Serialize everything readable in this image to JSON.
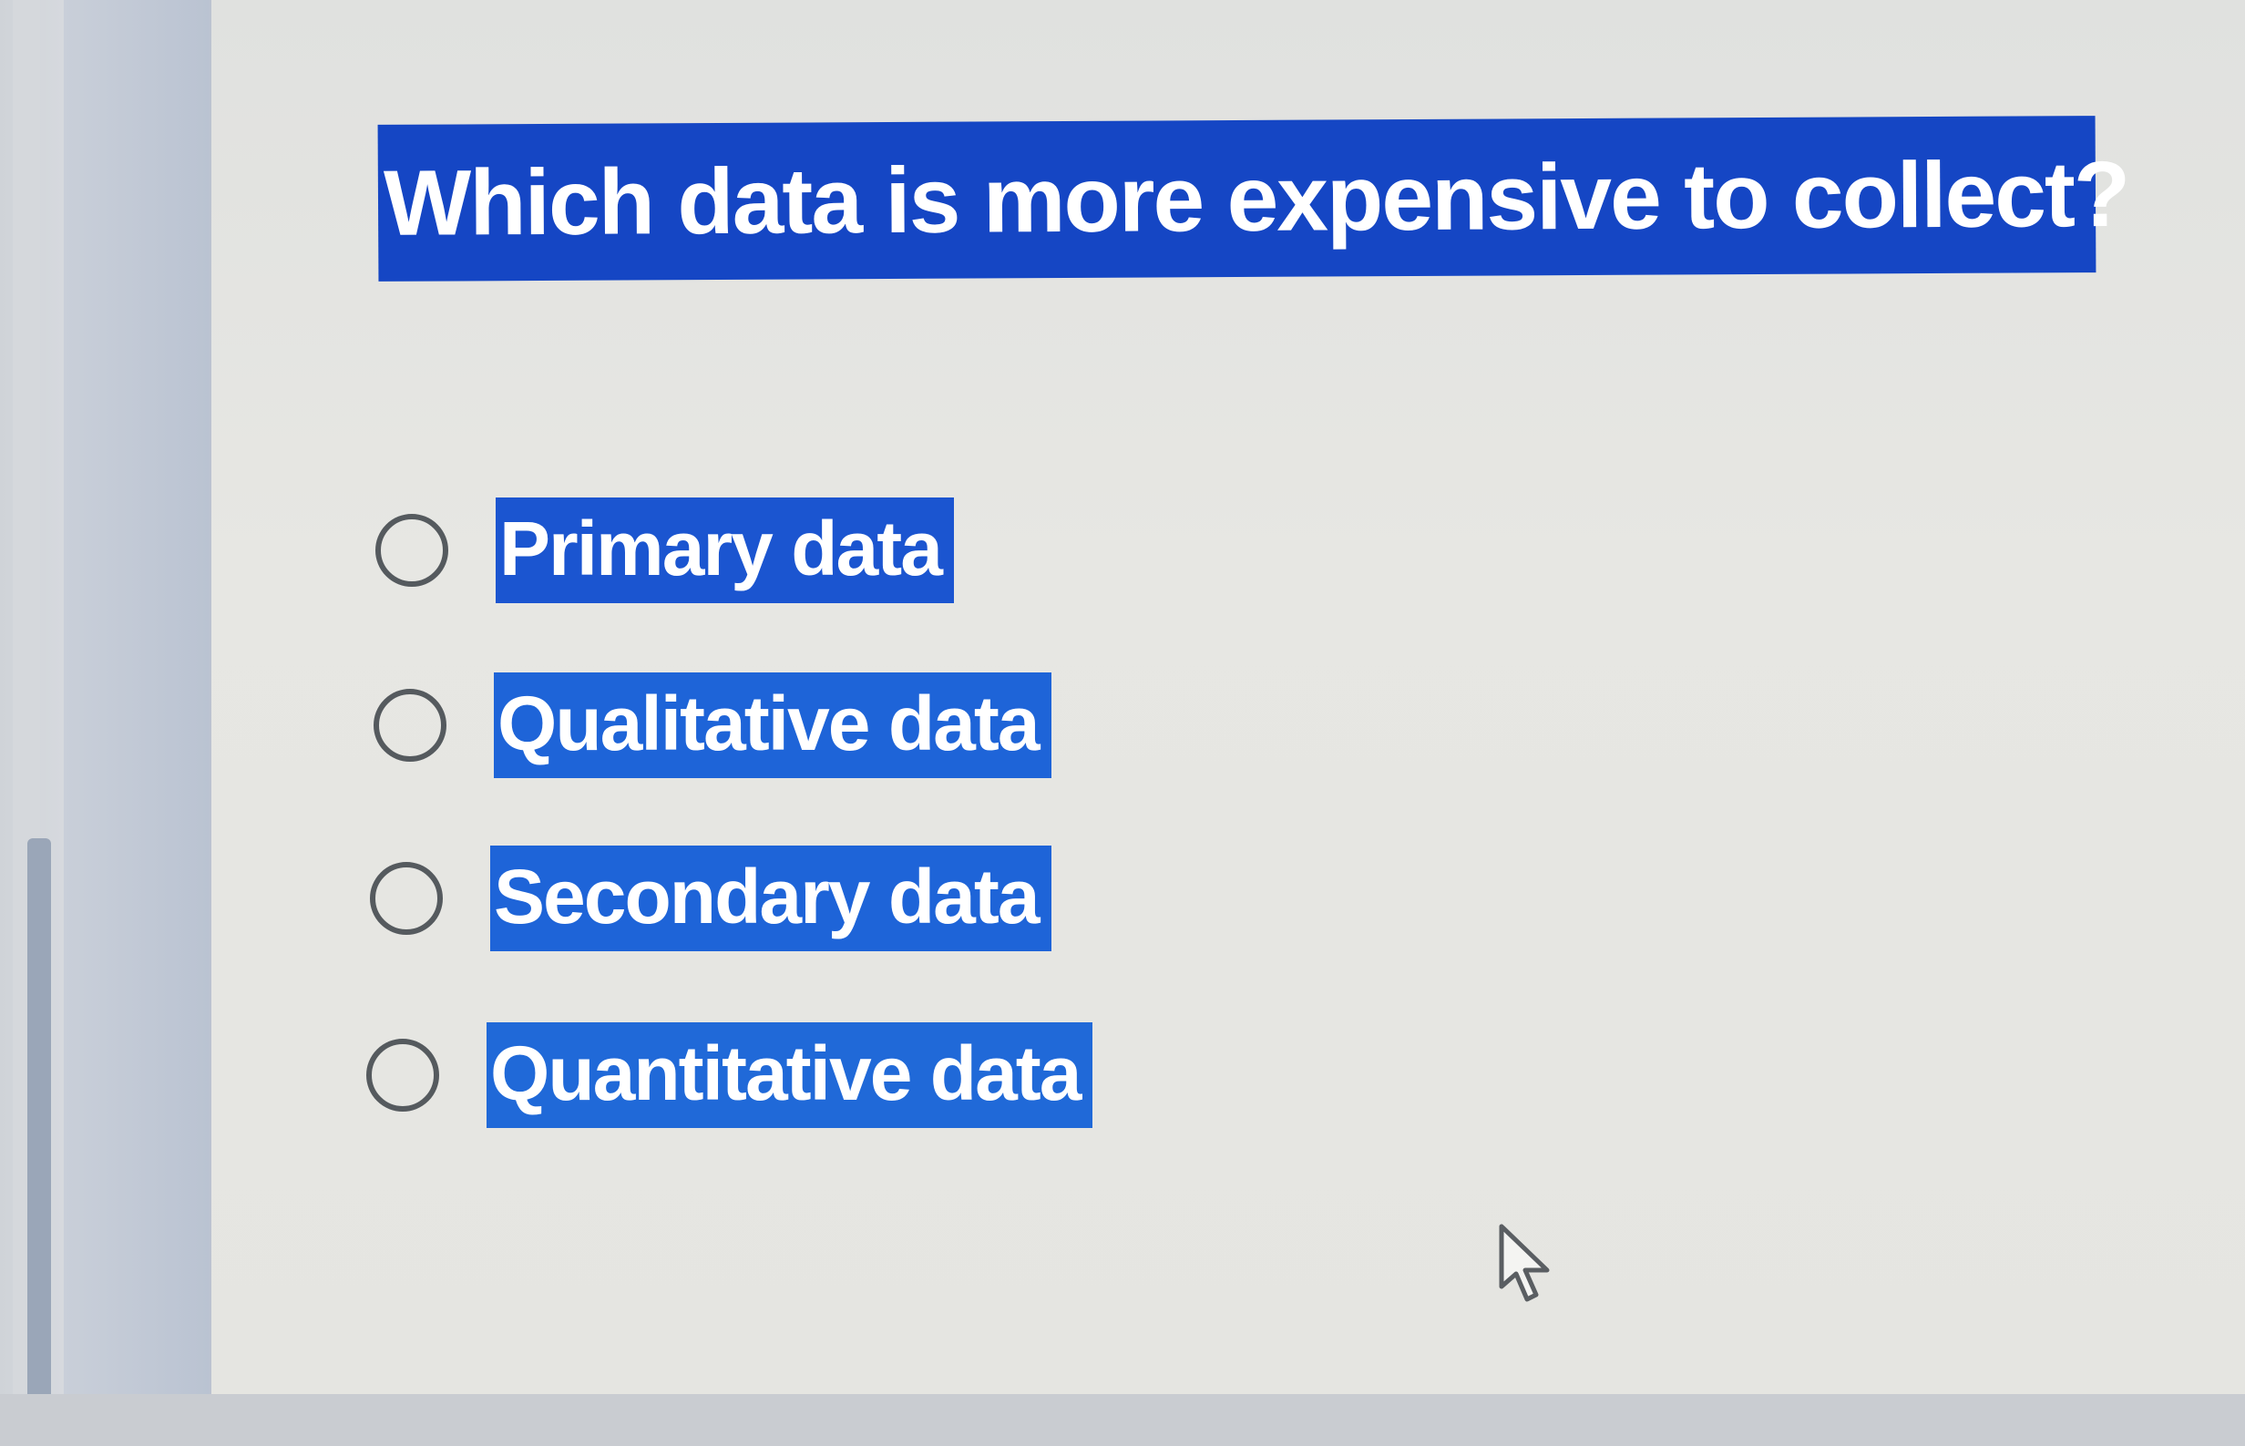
{
  "quiz": {
    "question": "Which data is more expensive to collect?",
    "options": [
      {
        "label": "Primary data",
        "selected": false
      },
      {
        "label": "Qualitative data",
        "selected": false
      },
      {
        "label": "Secondary data",
        "selected": false
      },
      {
        "label": "Quantitative data",
        "selected": false
      }
    ]
  },
  "icons": {
    "radio": "radio-unchecked-icon",
    "cursor": "mouse-pointer-icon"
  },
  "colors": {
    "question_highlight": "#1546c4",
    "option_highlight": "#1e64d8",
    "radio_border": "#555a5e",
    "text": "#ffffff"
  }
}
